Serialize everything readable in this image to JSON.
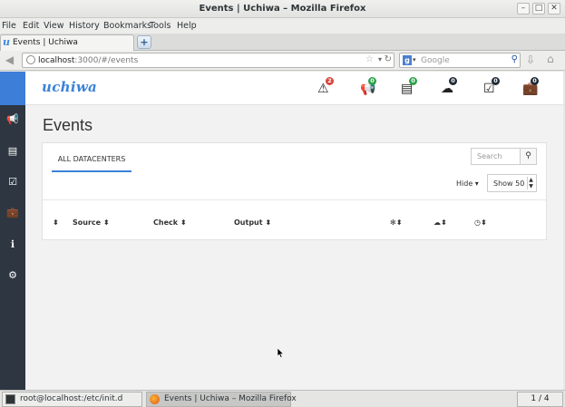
{
  "window": {
    "title": "Events | Uchiwa – Mozilla Firefox"
  },
  "menu": [
    "File",
    "Edit",
    "View",
    "History",
    "Bookmarks",
    "Tools",
    "Help"
  ],
  "browser": {
    "tab_title": "Events | Uchiwa",
    "url_host": "localhost",
    "url_rest": ":3000/#/events",
    "search_placeholder": "Google"
  },
  "uchiwa": {
    "logo": "uchiwa",
    "nav_icons": [
      {
        "name": "events-icon",
        "glyph": "⚠",
        "badge": "2",
        "badge_color": "#d9453d"
      },
      {
        "name": "stashes-megaphone-icon",
        "glyph": "📢",
        "badge": "0",
        "badge_color": "#2ea14b"
      },
      {
        "name": "clients-hdd-icon",
        "glyph": "▤",
        "badge": "0",
        "badge_color": "#2ea14b"
      },
      {
        "name": "datacenters-cloud-icon",
        "glyph": "☁",
        "badge": "0",
        "badge_color": "#1f2a36"
      },
      {
        "name": "checks-icon",
        "glyph": "☑",
        "badge": "0",
        "badge_color": "#1f2a36"
      },
      {
        "name": "aggregates-briefcase-icon",
        "glyph": "💼",
        "badge": "0",
        "badge_color": "#1f2a36"
      }
    ],
    "page_title": "Events",
    "datacenter_tab": "ALL DATACENTERS",
    "search_placeholder": "Search",
    "hide_label": "Hide ▾",
    "show_label": "Show 50",
    "columns": {
      "source": "Source ⬍",
      "check": "Check ⬍",
      "output": "Output ⬍"
    }
  },
  "taskbar": {
    "terminal": "root@localhost:/etc/init.d",
    "firefox": "Events | Uchiwa – Mozilla Firefox",
    "pager": "1 / 4"
  },
  "colors": {
    "accent": "#3b82d8",
    "sidebar": "#2d3641",
    "brand_block": "#3d7ed8"
  }
}
